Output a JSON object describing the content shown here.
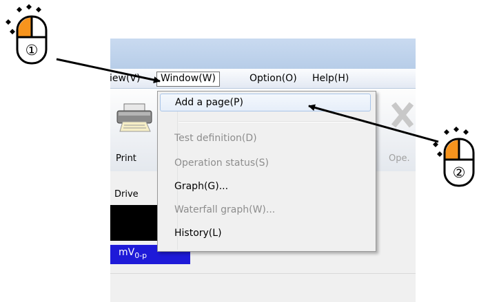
{
  "menu_bar": {
    "partial_item": "iew(V)",
    "window": "Window(W)",
    "option": "Option(O)",
    "help": "Help(H)"
  },
  "window_menu": {
    "items": [
      {
        "label": "Add a page(P)",
        "enabled": true,
        "highlighted": true
      },
      {
        "label": "Test definition(D)",
        "enabled": false
      },
      {
        "label": "Operation status(S)",
        "enabled": false
      },
      {
        "label": "Graph(G)...",
        "enabled": true
      },
      {
        "label": "Waterfall graph(W)...",
        "enabled": false
      },
      {
        "label": "History(L)",
        "enabled": true
      }
    ]
  },
  "toolbar": {
    "print_label": "Print",
    "ope_label": "Ope."
  },
  "panel": {
    "drive_label": "Drive",
    "unit": "mV",
    "unit_sub": "0-p"
  },
  "annotations": {
    "step1": "①",
    "step2": "②"
  },
  "colors": {
    "highlight_border": "#a8c4e8",
    "mouse_button": "#f7941d",
    "unit_box": "#1e1ad8",
    "title_bar": "#c9daf0"
  }
}
